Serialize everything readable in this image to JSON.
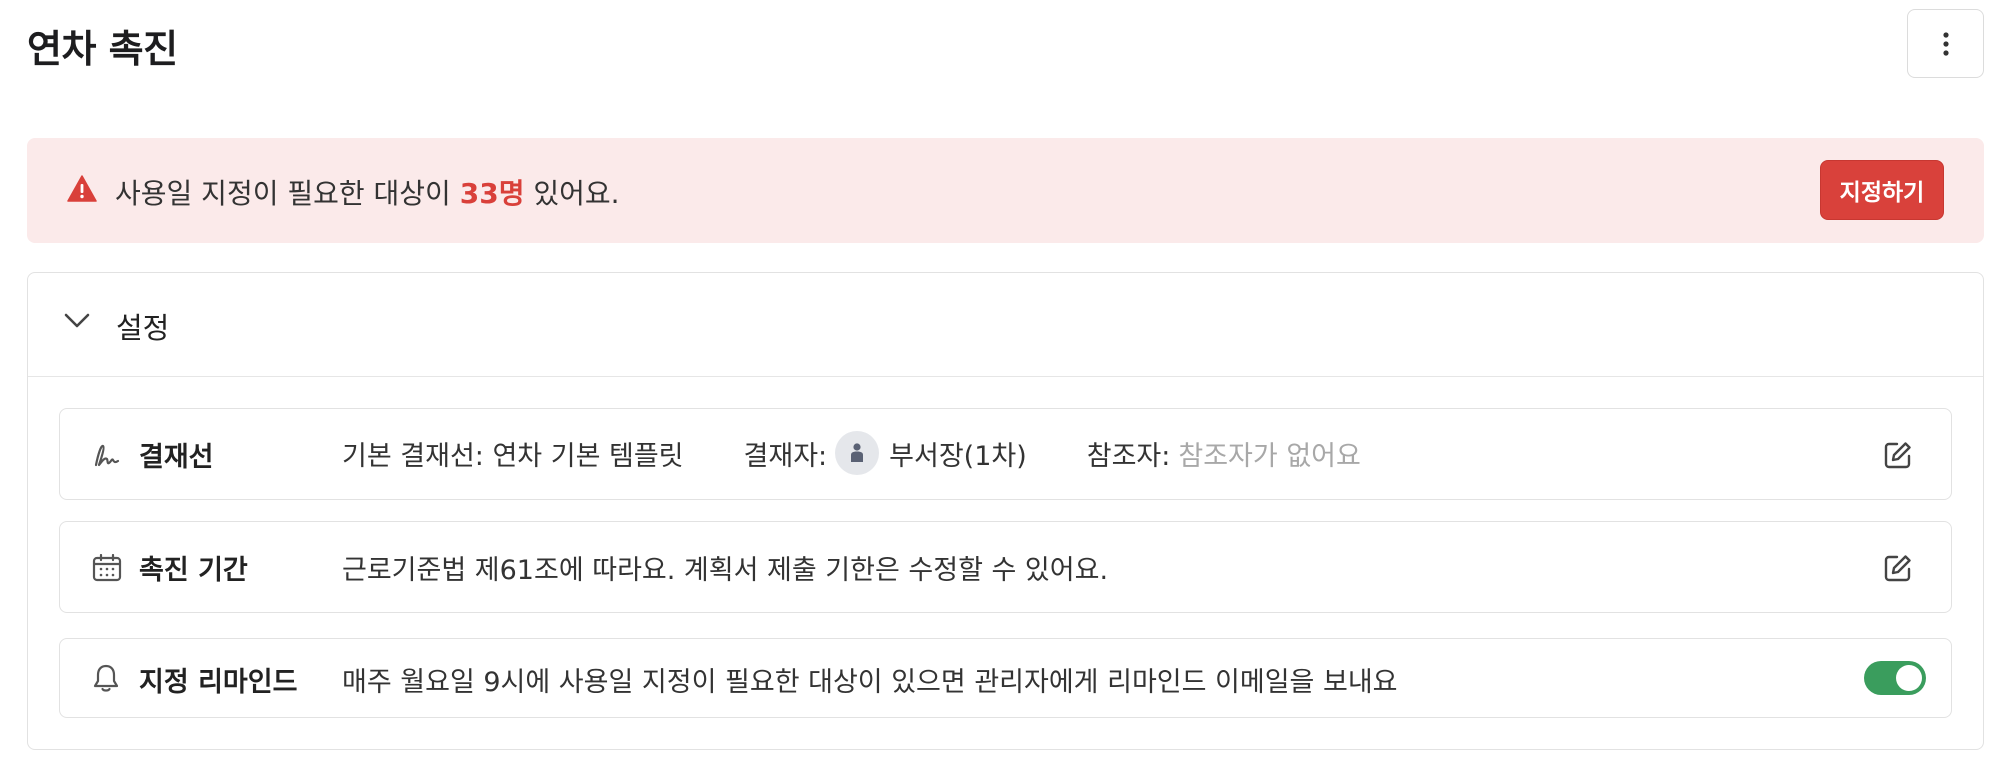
{
  "page": {
    "title": "연차 촉진"
  },
  "alert": {
    "prefix": "사용일 지정이 필요한 대상이 ",
    "count": "33명",
    "suffix": " 있어요.",
    "button_label": "지정하기",
    "icon": "warning-triangle-icon",
    "accent_color": "#d9403a",
    "background_color": "#fbeaea"
  },
  "settings": {
    "title": "설정",
    "expanded": true,
    "rows": {
      "approval": {
        "icon": "signature-icon",
        "label": "결재선",
        "line_text": "기본 결재선: 연차 기본 템플릿",
        "approver_label": "결재자:",
        "approver_name": "부서장(1차)",
        "reference_label": "참조자:",
        "reference_empty": "참조자가 없어요"
      },
      "period": {
        "icon": "calendar-icon",
        "label": "촉진 기간",
        "description": "근로기준법 제61조에 따라요. 계획서 제출 기한은 수정할 수 있어요."
      },
      "reminder": {
        "icon": "bell-icon",
        "label": "지정 리마인드",
        "description": "매주 월요일 9시에 사용일 지정이 필요한 대상이 있으면 관리자에게 리마인드 이메일을 보내요",
        "enabled": true,
        "toggle_color": "#3a9d5d"
      }
    }
  }
}
